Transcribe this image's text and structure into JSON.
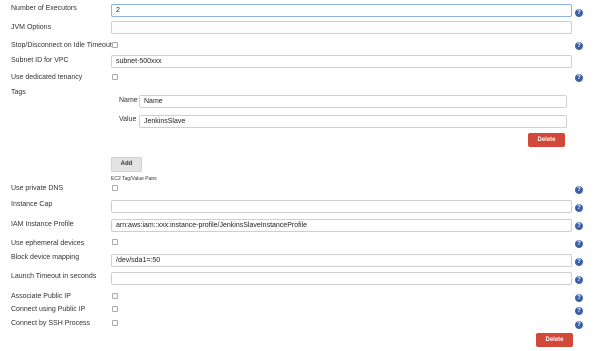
{
  "fields": {
    "executors": {
      "label": "Number of Executors",
      "value": "2"
    },
    "jvm": {
      "label": "JVM Options",
      "value": ""
    },
    "stop_idle": {
      "label": "Stop/Disconnect on Idle Timeout"
    },
    "subnet": {
      "label": "Subnet ID for VPC",
      "value": "subnet-500xxx"
    },
    "tenancy": {
      "label": "Use dedicated tenancy"
    },
    "tags": {
      "label": "Tags",
      "name_label": "Name",
      "name_value": "Name",
      "value_label": "Value",
      "value_value": "JenkinsSlave",
      "delete_label": "Delete",
      "add_label": "Add",
      "hint": "EC2 Tag/Value Pairs"
    },
    "private_dns": {
      "label": "Use private DNS"
    },
    "instance_cap": {
      "label": "Instance Cap",
      "value": ""
    },
    "iam_profile": {
      "label": "IAM Instance Profile",
      "value": "arn:aws:iam::xxx:instance-profile/JenkinsSlaveInstanceProfile"
    },
    "ephemeral": {
      "label": "Use ephemeral devices"
    },
    "block_device": {
      "label": "Block device mapping",
      "value": "/dev/sda1=:50"
    },
    "launch_timeout": {
      "label": "Launch Timeout in seconds",
      "value": ""
    },
    "assoc_public_ip": {
      "label": "Associate Public IP"
    },
    "connect_public_ip": {
      "label": "Connect using Public IP"
    },
    "ssh_process": {
      "label": "Connect by SSH Process"
    }
  },
  "footer": {
    "delete_label": "Delete"
  },
  "help_glyph": "?",
  "icons": {
    "help": "help-icon"
  },
  "colors": {
    "delete": "#d24939",
    "help": "#3b62a8"
  }
}
